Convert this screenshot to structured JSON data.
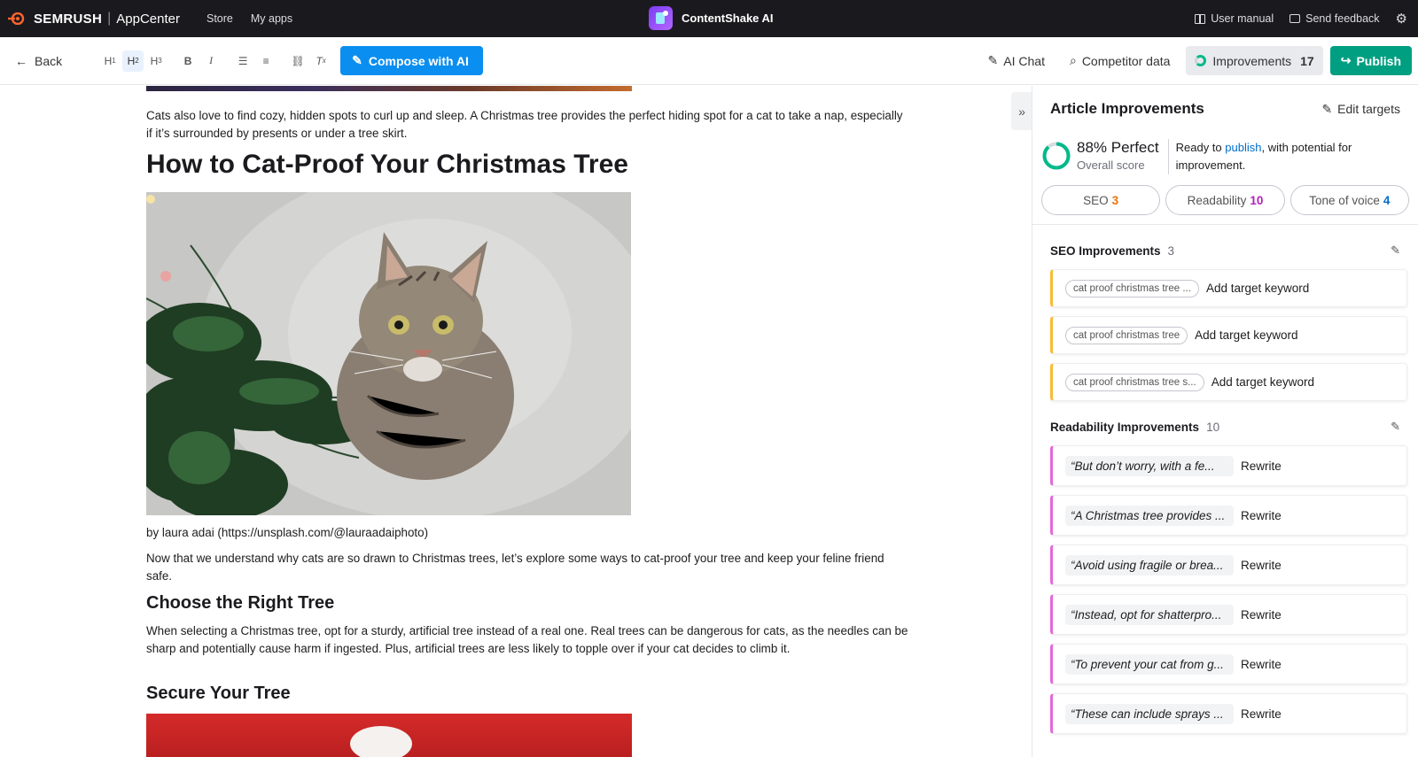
{
  "topbar": {
    "brand": "SEMRUSH",
    "appcenter": "AppCenter",
    "nav": [
      "Store",
      "My apps"
    ],
    "app_name": "ContentShake AI",
    "user_manual": "User manual",
    "send_feedback": "Send feedback"
  },
  "toolbar": {
    "back": "Back",
    "format_buttons": [
      "H1",
      "H2",
      "H3",
      "B",
      "I"
    ],
    "compose": "Compose with AI",
    "ai_chat": "AI Chat",
    "competitor": "Competitor data",
    "improvements": "Improvements",
    "improvements_count": "17",
    "publish": "Publish"
  },
  "article": {
    "para1": "Cats also love to find cozy, hidden spots to curl up and sleep. A Christmas tree provides the perfect hiding spot for a cat to take a nap, especially if it’s surrounded by presents or under a tree skirt.",
    "heading1": "How to Cat-Proof Your Christmas Tree",
    "caption": "by laura adai (https://unsplash.com/@lauraadaiphoto)",
    "para2": "Now that we understand why cats are so drawn to Christmas trees, let’s explore some ways to cat-proof your tree and keep your feline friend safe.",
    "heading2": "Choose the Right Tree",
    "para3": "When selecting a Christmas tree, opt for a sturdy, artificial tree instead of a real one. Real trees can be dangerous for cats, as the needles can be sharp and potentially cause harm if ingested. Plus, artificial trees are less likely to topple over if your cat decides to climb it.",
    "heading3": "Secure Your Tree"
  },
  "panel": {
    "title": "Article Improvements",
    "edit_targets": "Edit targets",
    "score": "88% Perfect",
    "score_value": 88,
    "score_sub": "Overall score",
    "msg_before": "Ready to ",
    "msg_link": "publish",
    "msg_after": ", with potential for improvement.",
    "pills": [
      {
        "label": "SEO",
        "count": "3",
        "color": "#e8730c"
      },
      {
        "label": "Readability",
        "count": "10",
        "color": "#b022b8"
      },
      {
        "label": "Tone of voice",
        "count": "4",
        "color": "#006dca"
      }
    ],
    "seo": {
      "title": "SEO Improvements",
      "count": "3",
      "items": [
        {
          "chip": "cat proof christmas tree ...",
          "action": "Add target keyword"
        },
        {
          "chip": "cat proof christmas tree",
          "action": "Add target keyword"
        },
        {
          "chip": "cat proof christmas tree s...",
          "action": "Add target keyword"
        }
      ]
    },
    "readability": {
      "title": "Readability Improvements",
      "count": "10",
      "items": [
        {
          "quote": "“But don’t worry, with a fe...",
          "action": "Rewrite"
        },
        {
          "quote": "“A Christmas tree provides ...",
          "action": "Rewrite"
        },
        {
          "quote": "“Avoid using fragile or brea...",
          "action": "Rewrite"
        },
        {
          "quote": "“Instead, opt for shatterpro...",
          "action": "Rewrite"
        },
        {
          "quote": "“To prevent your cat from g...",
          "action": "Rewrite"
        },
        {
          "quote": "“These can include sprays ...",
          "action": "Rewrite"
        }
      ]
    }
  },
  "colors": {
    "accent": "#0a8ef0",
    "publish": "#009f81",
    "seo_bar": "#f8bb33",
    "readability_bar": "#e667d9",
    "score_ring": "#00b98a"
  }
}
